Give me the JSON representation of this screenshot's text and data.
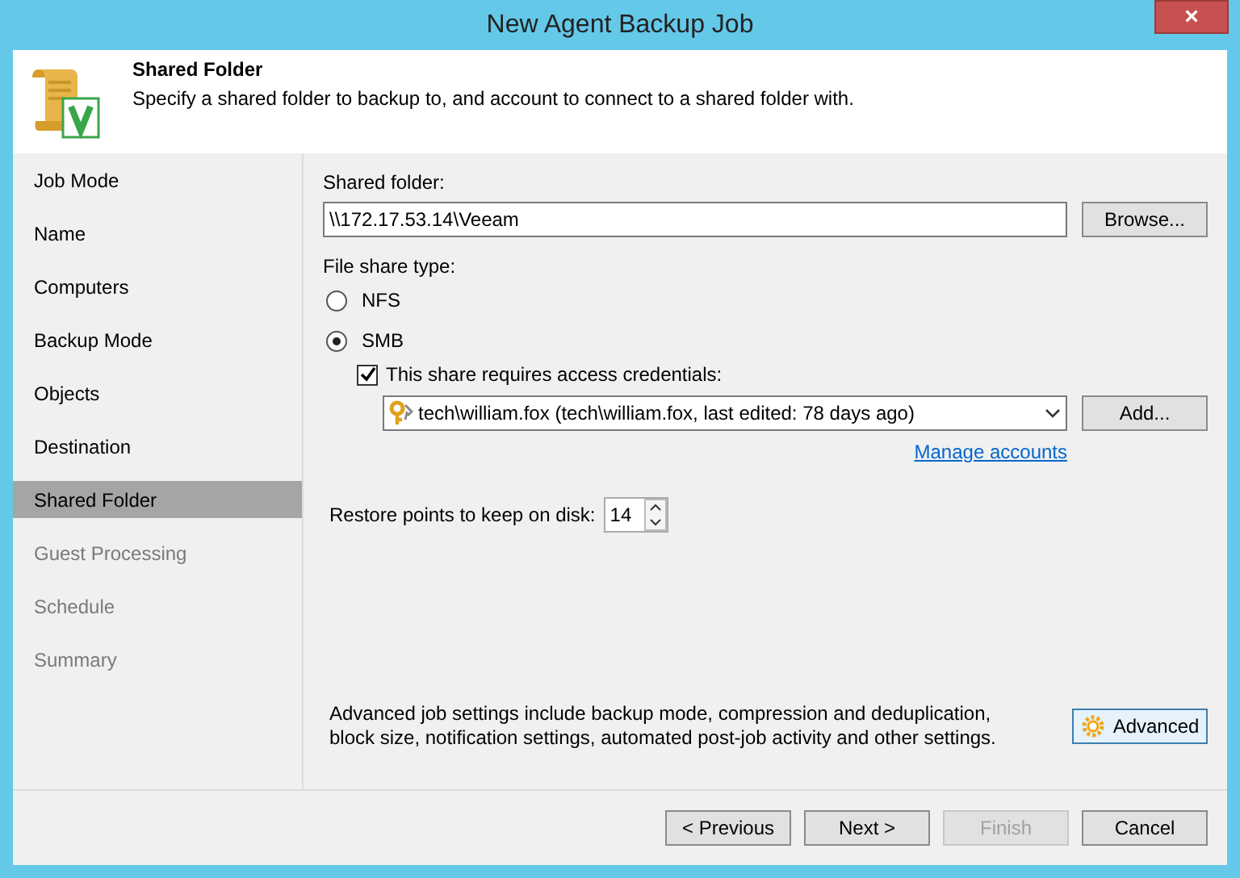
{
  "window": {
    "title": "New Agent Backup Job",
    "close": "×"
  },
  "header": {
    "title": "Shared Folder",
    "description": "Specify a shared folder to backup to, and account to connect to a shared folder with."
  },
  "steps": [
    {
      "label": "Job Mode",
      "selected": false,
      "disabled": false
    },
    {
      "label": "Name",
      "selected": false,
      "disabled": false
    },
    {
      "label": "Computers",
      "selected": false,
      "disabled": false
    },
    {
      "label": "Backup Mode",
      "selected": false,
      "disabled": false
    },
    {
      "label": "Objects",
      "selected": false,
      "disabled": false
    },
    {
      "label": "Destination",
      "selected": false,
      "disabled": false
    },
    {
      "label": "Shared Folder",
      "selected": true,
      "disabled": false
    },
    {
      "label": "Guest Processing",
      "selected": false,
      "disabled": true
    },
    {
      "label": "Schedule",
      "selected": false,
      "disabled": true
    },
    {
      "label": "Summary",
      "selected": false,
      "disabled": true
    }
  ],
  "shared_folder": {
    "label": "Shared folder:",
    "value": "\\\\172.17.53.14\\Veeam",
    "button": "Browse..."
  },
  "file_share_type": {
    "label": "File share type:",
    "options": [
      {
        "label": "NFS",
        "selected": false
      },
      {
        "label": "SMB",
        "selected": true
      }
    ]
  },
  "credentials": {
    "label": "This share requires access credentials:",
    "checked": true,
    "account": "tech\\william.fox (tech\\william.fox, last edited: 78 days ago)",
    "button": "Add...",
    "link": "Manage accounts"
  },
  "restore_points": {
    "label": "Restore points to keep on disk:",
    "value": "14"
  },
  "advanced": {
    "text": "Advanced job settings include backup mode, compression and deduplication, block size, notification settings, automated post-job activity and other settings.",
    "button": "Advanced"
  },
  "buttons": [
    {
      "label": "< Previous",
      "disabled": false
    },
    {
      "label": "Next >",
      "disabled": false
    },
    {
      "label": "Finish",
      "disabled": true
    },
    {
      "label": "Cancel",
      "disabled": false
    }
  ]
}
